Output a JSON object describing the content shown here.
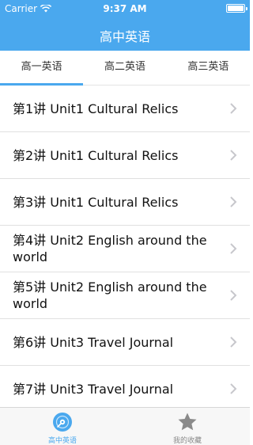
{
  "status_bar": {
    "carrier": "Carrier",
    "time": "9:37 AM"
  },
  "nav": {
    "title": "高中英语"
  },
  "tabs": [
    {
      "label": "高一英语",
      "active": true
    },
    {
      "label": "高二英语",
      "active": false
    },
    {
      "label": "高三英语",
      "active": false
    }
  ],
  "lessons": [
    {
      "label": "第1讲 Unit1 Cultural Relics"
    },
    {
      "label": "第2讲 Unit1 Cultural Relics"
    },
    {
      "label": "第3讲 Unit1 Cultural Relics"
    },
    {
      "label": "第4讲 Unit2 English around the world"
    },
    {
      "label": "第5讲 Unit2 English around the world"
    },
    {
      "label": "第6讲 Unit3 Travel Journal"
    },
    {
      "label": "第7讲 Unit3 Travel Journal"
    }
  ],
  "tabbar": [
    {
      "label": "高中英语",
      "icon": "disc-icon",
      "active": true
    },
    {
      "label": "我的收藏",
      "icon": "star-icon",
      "active": false
    }
  ],
  "colors": {
    "accent": "#4aa8ee",
    "chevron": "#c7c7cc",
    "inactive_icon": "#8a8a8a"
  }
}
